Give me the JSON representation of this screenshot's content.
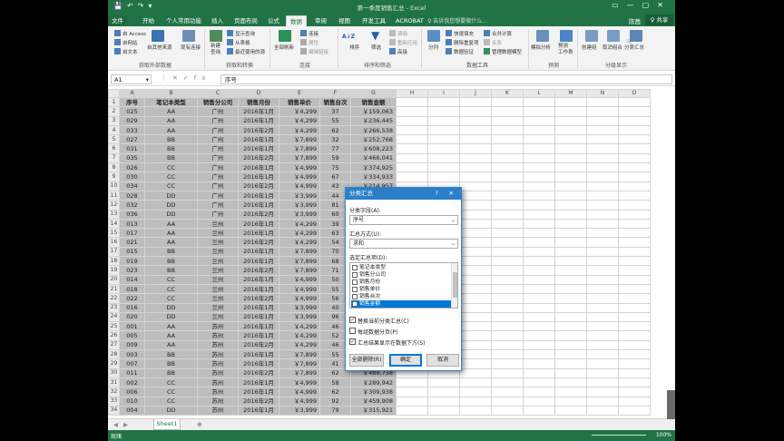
{
  "window": {
    "doc_title": "第一季度销售汇总 - Excel",
    "quick_access": [
      "💾",
      "↶",
      "↷",
      "▾"
    ],
    "controls": [
      "▭",
      "—",
      "▢",
      "✕"
    ]
  },
  "tabs": [
    "文件",
    "开始",
    "个人常用功能",
    "插入",
    "页面布局",
    "公式",
    "数据",
    "审阅",
    "视图",
    "开发工具",
    "ACROBAT"
  ],
  "active_tab": "数据",
  "tell_me": "♀ 告诉我您想要做什么...",
  "user": "陈茜",
  "share": "♀ 共享",
  "ribbon": {
    "external": [
      "自 Access",
      "自网站",
      "自文本"
    ],
    "other_sources": "自其他来源",
    "existing": "现有连接",
    "new_query": "新建\n查询",
    "query_items": [
      "显示查询",
      "从表格",
      "最近使用的源"
    ],
    "refresh_all": "全部刷新",
    "conn_items": [
      "连接",
      "属性",
      "编辑链接"
    ],
    "sort_az": "A↓Z",
    "sort": "排序",
    "filter": "筛选",
    "filter_items": [
      "清除",
      "重新应用",
      "高级"
    ],
    "split": "分列",
    "tools_items": [
      "快速填充",
      "删除重复项",
      "数据验证"
    ],
    "tools_items2": [
      "合并计算",
      "关系",
      "管理数据模型"
    ],
    "whatif": "模拟分析",
    "forecast": "预测\n工作表",
    "group": "创建组",
    "ungroup": "取消组合",
    "subtotal": "分类汇总",
    "groups": [
      "获取外部数据",
      "获取和转换",
      "连接",
      "排序和筛选",
      "数据工具",
      "预测",
      "分级显示"
    ]
  },
  "formula_bar": {
    "name_box": "A1",
    "icons": [
      "▾",
      "⋮",
      "✕",
      "✓",
      "fx"
    ],
    "value": "序号"
  },
  "columns": [
    "A",
    "B",
    "C",
    "D",
    "E",
    "F",
    "G",
    "H",
    "I",
    "J",
    "K",
    "L",
    "M",
    "N",
    "O"
  ],
  "headers": [
    "序号",
    "笔记本类型",
    "销售分公司",
    "销售月份",
    "销售单价",
    "销售台次",
    "销售金额"
  ],
  "rows": [
    [
      "025",
      "AA",
      "广州",
      "2016年1月",
      "￥4,299",
      "37",
      "￥159,063"
    ],
    [
      "029",
      "AA",
      "广州",
      "2016年1月",
      "￥4,299",
      "55",
      "￥236,445"
    ],
    [
      "033",
      "AA",
      "广州",
      "2016年2月",
      "￥4,299",
      "62",
      "￥266,538"
    ],
    [
      "027",
      "BB",
      "广州",
      "2016年1月",
      "￥7,899",
      "32",
      "￥252,768"
    ],
    [
      "031",
      "BB",
      "广州",
      "2016年1月",
      "￥7,899",
      "77",
      "￥608,223"
    ],
    [
      "035",
      "BB",
      "广州",
      "2016年2月",
      "￥7,899",
      "59",
      "￥466,041"
    ],
    [
      "026",
      "CC",
      "广州",
      "2016年1月",
      "￥4,999",
      "75",
      "￥374,925"
    ],
    [
      "030",
      "CC",
      "广州",
      "2016年1月",
      "￥4,999",
      "67",
      "￥334,933"
    ],
    [
      "034",
      "CC",
      "广州",
      "2016年2月",
      "￥4,999",
      "43",
      "￥214,957"
    ],
    [
      "028",
      "DD",
      "广州",
      "2016年1月",
      "￥3,999",
      "44",
      ""
    ],
    [
      "032",
      "DD",
      "广州",
      "2016年1月",
      "￥3,999",
      "81",
      ""
    ],
    [
      "036",
      "DD",
      "广州",
      "2016年2月",
      "￥3,999",
      "60",
      ""
    ],
    [
      "013",
      "AA",
      "兰州",
      "2016年1月",
      "￥4,299",
      "39",
      ""
    ],
    [
      "017",
      "AA",
      "兰州",
      "2016年1月",
      "￥4,299",
      "63",
      ""
    ],
    [
      "021",
      "AA",
      "兰州",
      "2016年2月",
      "￥4,299",
      "54",
      ""
    ],
    [
      "015",
      "BB",
      "兰州",
      "2016年1月",
      "￥7,899",
      "70",
      ""
    ],
    [
      "019",
      "BB",
      "兰州",
      "2016年1月",
      "￥7,899",
      "68",
      ""
    ],
    [
      "023",
      "BB",
      "兰州",
      "2016年2月",
      "￥7,899",
      "71",
      ""
    ],
    [
      "014",
      "CC",
      "兰州",
      "2016年1月",
      "￥4,999",
      "50",
      ""
    ],
    [
      "018",
      "CC",
      "兰州",
      "2016年1月",
      "￥4,999",
      "55",
      ""
    ],
    [
      "022",
      "CC",
      "兰州",
      "2016年2月",
      "￥4,999",
      "56",
      ""
    ],
    [
      "016",
      "DD",
      "兰州",
      "2016年1月",
      "￥3,999",
      "40",
      ""
    ],
    [
      "020",
      "DD",
      "兰州",
      "2016年1月",
      "￥3,999",
      "96",
      ""
    ],
    [
      "001",
      "AA",
      "苏州",
      "2016年1月",
      "￥4,299",
      "46",
      ""
    ],
    [
      "005",
      "AA",
      "苏州",
      "2016年1月",
      "￥4,299",
      "52",
      ""
    ],
    [
      "009",
      "AA",
      "苏州",
      "2016年2月",
      "￥4,299",
      "46",
      ""
    ],
    [
      "003",
      "BB",
      "苏州",
      "2016年1月",
      "￥7,899",
      "55",
      ""
    ],
    [
      "007",
      "BB",
      "苏州",
      "2016年1月",
      "￥7,899",
      "41",
      "￥323,859"
    ],
    [
      "011",
      "BB",
      "苏州",
      "2016年2月",
      "￥7,899",
      "62",
      "￥489,738"
    ],
    [
      "002",
      "CC",
      "苏州",
      "2016年1月",
      "￥4,999",
      "58",
      "￥289,942"
    ],
    [
      "006",
      "CC",
      "苏州",
      "2016年1月",
      "￥4,999",
      "62",
      "￥309,938"
    ],
    [
      "010",
      "CC",
      "苏州",
      "2016年2月",
      "￥4,999",
      "92",
      "￥459,908"
    ],
    [
      "004",
      "DD",
      "苏州",
      "2016年1月",
      "￥3,999",
      "79",
      "￥315,921"
    ]
  ],
  "sheet_tab": "Sheet1",
  "sheet_nav": [
    "◀",
    "▶"
  ],
  "add_sheet": "⊕",
  "status": {
    "ready": "就绪",
    "zoom": "100%"
  },
  "dialog": {
    "title": "分类汇总",
    "help": "?",
    "close": "✕",
    "field_label": "分类字段(A):",
    "field_value": "序号",
    "method_label": "汇总方式(U):",
    "method_value": "求和",
    "items_label": "选定汇总项(D):",
    "items": [
      {
        "label": "笔记本类型",
        "checked": false
      },
      {
        "label": "销售分公司",
        "checked": false
      },
      {
        "label": "销售月份",
        "checked": false
      },
      {
        "label": "销售单价",
        "checked": false
      },
      {
        "label": "销售台次",
        "checked": false
      },
      {
        "label": "销售金额",
        "checked": true
      }
    ],
    "options": [
      {
        "label": "替换当前分类汇总(C)",
        "checked": true
      },
      {
        "label": "每组数据分页(P)",
        "checked": false
      },
      {
        "label": "汇总结果显示在数据下方(S)",
        "checked": true
      }
    ],
    "remove_all": "全部删除(R)",
    "ok": "确定",
    "cancel": "取消"
  }
}
